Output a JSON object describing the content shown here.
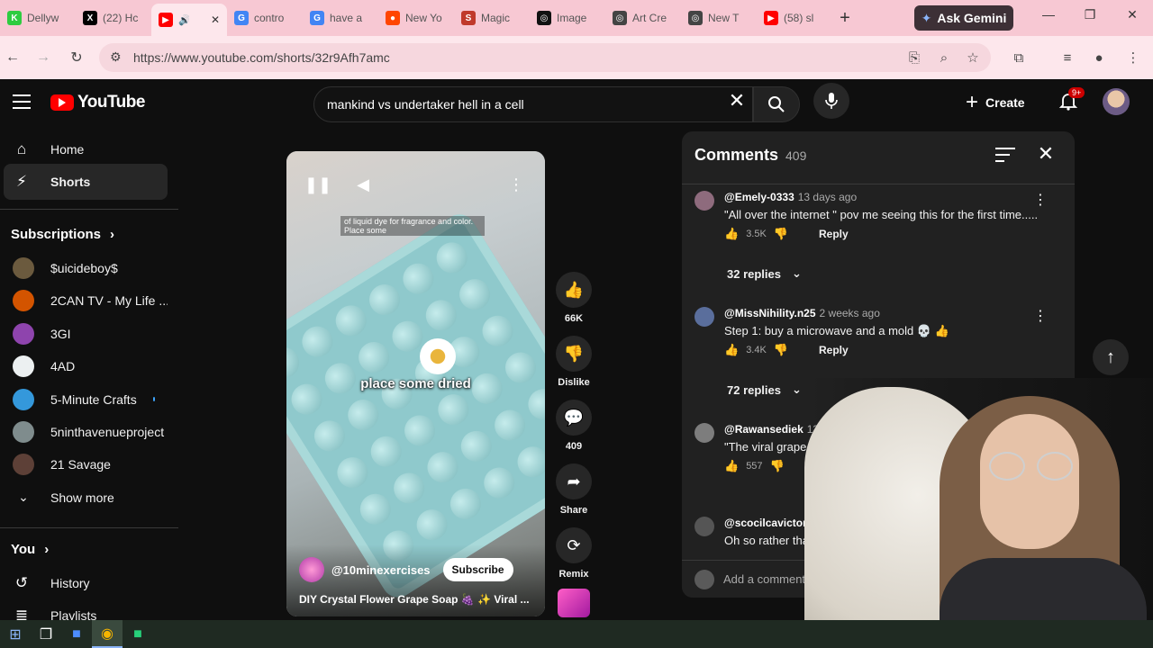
{
  "browser": {
    "tabs": [
      {
        "title": "Dellyw",
        "icon": "k-icon",
        "color": "#2ecc40",
        "glyph": "K"
      },
      {
        "title": "(22) Hc",
        "icon": "x-icon",
        "color": "#000000",
        "glyph": "X"
      },
      {
        "title": "",
        "icon": "youtube-icon",
        "color": "#ff0000",
        "glyph": "▶",
        "active": true
      },
      {
        "title": "contro",
        "icon": "google-icon",
        "color": "#4285f4",
        "glyph": "G"
      },
      {
        "title": "have a",
        "icon": "google-icon",
        "color": "#4285f4",
        "glyph": "G"
      },
      {
        "title": "New Yo",
        "icon": "reddit-icon",
        "color": "#ff4500",
        "glyph": "●"
      },
      {
        "title": "Magic",
        "icon": "s-icon",
        "color": "#c0392b",
        "glyph": "S"
      },
      {
        "title": "Image",
        "icon": "openai-icon",
        "color": "#111111",
        "glyph": "◎"
      },
      {
        "title": "Art Cre",
        "icon": "openai-icon",
        "color": "#444444",
        "glyph": "◎"
      },
      {
        "title": "New T",
        "icon": "openai-icon",
        "color": "#444444",
        "glyph": "◎"
      },
      {
        "title": "(58) sl",
        "icon": "youtube-icon",
        "color": "#ff0000",
        "glyph": "▶"
      }
    ],
    "ask_gemini": "Ask Gemini",
    "url": "https://www.youtube.com/shorts/32r9Afh7amc"
  },
  "youtube": {
    "logo_text": "YouTube",
    "search_query": "mankind vs undertaker hell in a cell",
    "create_label": "Create",
    "notif_badge": "9+"
  },
  "sidebar": {
    "items": [
      {
        "label": "Home",
        "icon": "home-icon"
      },
      {
        "label": "Shorts",
        "icon": "shorts-icon",
        "selected": true
      }
    ],
    "subscriptions_title": "Subscriptions",
    "subscriptions": [
      {
        "label": "$uicideboy$",
        "color": "#6b5a3e",
        "new": false
      },
      {
        "label": "2CAN TV - My Life ...",
        "color": "#d35400",
        "new": false
      },
      {
        "label": "3GI",
        "color": "#8e44ad",
        "new": false
      },
      {
        "label": "4AD",
        "color": "#ecf0f1",
        "new": false
      },
      {
        "label": "5-Minute Crafts",
        "color": "#3498db",
        "new": true
      },
      {
        "label": "5ninthavenueproject",
        "color": "#7f8c8d",
        "new": false
      },
      {
        "label": "21 Savage",
        "color": "#5d4037",
        "new": false
      }
    ],
    "show_more": "Show more",
    "you_title": "You",
    "you_items": [
      {
        "label": "History",
        "icon": "history-icon"
      },
      {
        "label": "Playlists",
        "icon": "playlists-icon"
      }
    ]
  },
  "video": {
    "overlay_text": "of liquid dye for fragrance and color. Place some",
    "caption": "place some dried",
    "channel": "@10minexercises",
    "subscribe": "Subscribe",
    "title": "DIY Crystal Flower Grape Soap 🍇 ✨ Viral ..."
  },
  "actions": [
    {
      "icon": "like-icon",
      "glyph": "👍",
      "label": "66K"
    },
    {
      "icon": "dislike-icon",
      "glyph": "👎",
      "label": "Dislike"
    },
    {
      "icon": "comment-icon",
      "glyph": "💬",
      "label": "409"
    },
    {
      "icon": "share-icon",
      "glyph": "➦",
      "label": "Share"
    },
    {
      "icon": "remix-icon",
      "glyph": "⟳",
      "label": "Remix"
    }
  ],
  "comments": {
    "title": "Comments",
    "count": "409",
    "items": [
      {
        "user": "@Emely-0333",
        "time": "13 days ago",
        "text": "\"All over the internet \" pov me seeing this for the first time.....",
        "likes": "3.5K",
        "replies": "32 replies",
        "color": "#8e6b7d"
      },
      {
        "user": "@MissNihility.n25",
        "time": "2 weeks ago",
        "text": "Step 1: buy a microwave and a mold 💀 👍",
        "likes": "3.4K",
        "replies": "72 replies",
        "color": "#5a6e9c"
      },
      {
        "user": "@Rawansediek",
        "time": "13 days ago (edited)",
        "text": "\"The viral grape soap is all over in my life",
        "likes": "557",
        "replies": "",
        "color": "#7d7d7d"
      },
      {
        "user": "@scocilcavictor7521",
        "time": "",
        "text": "Oh so rather than",
        "likes": "",
        "replies": "",
        "color": "#555555"
      }
    ],
    "reply_label": "Reply",
    "add_placeholder": "Add a comment..."
  }
}
